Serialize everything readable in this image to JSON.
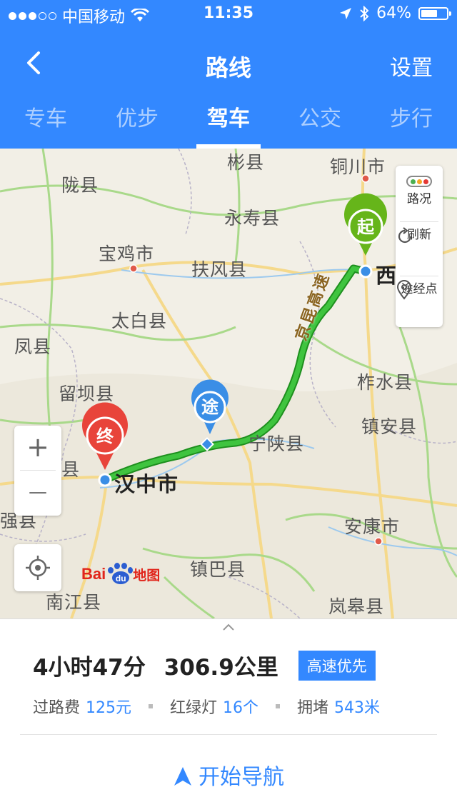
{
  "status_bar": {
    "carrier": "中国移动",
    "time": "11:35",
    "battery": "64%",
    "battery_level": 0.64,
    "signal_bars_filled": 3,
    "signal_bars_total": 5
  },
  "nav": {
    "title": "路线",
    "settings": "设置"
  },
  "tabs": [
    {
      "label": "专车",
      "active": false
    },
    {
      "label": "优步",
      "active": false
    },
    {
      "label": "驾车",
      "active": true
    },
    {
      "label": "公交",
      "active": false
    },
    {
      "label": "步行",
      "active": false
    }
  ],
  "map": {
    "labels": {
      "binxian": "彬县",
      "tongchuan": "铜川市",
      "longxian": "陇县",
      "yongshou": "永寿县",
      "baoji": "宝鸡市",
      "fufeng": "扶风县",
      "xian": "西安市",
      "taibai": "太白县",
      "fengxian": "凤县",
      "liuba": "留坝县",
      "zhashui": "柞水县",
      "zhenan": "镇安县",
      "ningshan": "宁陕县",
      "hanzhong": "汉中市",
      "ankang": "安康市",
      "zhenba": "镇巴县",
      "langao": "岚皋县",
      "nanjiang": "南江县",
      "mianxian_partial": "县",
      "ningqiang_partial": "强县",
      "highway": "京昆高速"
    },
    "pins": {
      "start": "起",
      "via": "途",
      "end": "终"
    },
    "controls": {
      "traffic": "路况",
      "refresh": "刷新",
      "waypoint": "途经点",
      "zoom_in": "+",
      "zoom_out": "—"
    },
    "logo": {
      "bai": "Bai",
      "du": "du",
      "map": "地图"
    },
    "colors": {
      "route": "#2db52d",
      "start_pin": "#66b51a",
      "end_pin": "#e8443a",
      "via_pin": "#3a8ee6"
    }
  },
  "route": {
    "duration": "4小时47分",
    "distance": "306.9公里",
    "tag": "高速优先",
    "toll_label": "过路费",
    "toll_value": "125元",
    "lights_label": "红绿灯",
    "lights_value": "16个",
    "congestion_label": "拥堵",
    "congestion_value": "543米",
    "start_navigation": "开始导航"
  }
}
